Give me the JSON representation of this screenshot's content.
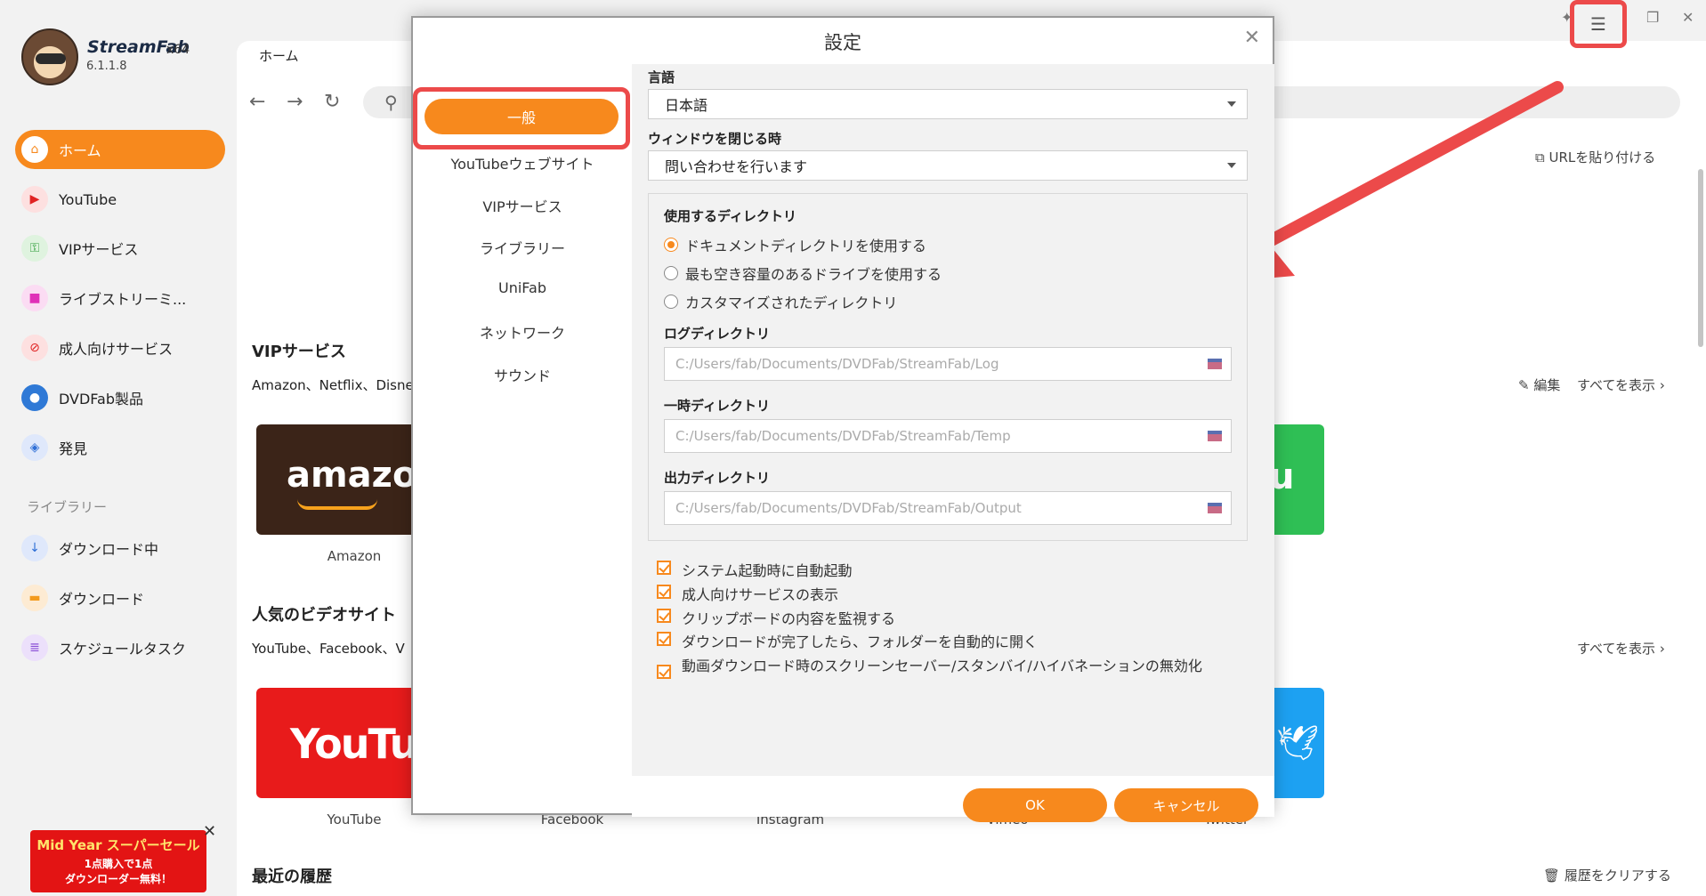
{
  "app": {
    "brand": "StreamFab",
    "arch": "x64",
    "version": "6.1.1.8"
  },
  "sidebar": {
    "items": [
      {
        "label": "ホーム",
        "icon": "home-icon"
      },
      {
        "label": "YouTube",
        "icon": "youtube-icon"
      },
      {
        "label": "VIPサービス",
        "icon": "key-icon"
      },
      {
        "label": "ライブストリーミ...",
        "icon": "live-camera-icon"
      },
      {
        "label": "成人向けサービス",
        "icon": "adult-block-icon"
      },
      {
        "label": "DVDFab製品",
        "icon": "dvdfab-icon"
      },
      {
        "label": "発見",
        "icon": "compass-icon"
      }
    ],
    "library_label": "ライブラリー",
    "library_items": [
      {
        "label": "ダウンロード中",
        "icon": "download-icon"
      },
      {
        "label": "ダウンロード",
        "icon": "folder-icon"
      },
      {
        "label": "スケジュールタスク",
        "icon": "schedule-icon"
      }
    ],
    "promo": {
      "line1": "Mid Year スーパーセール",
      "line2": "1点購入で1点",
      "line3": "ダウンローダー無料！"
    }
  },
  "main": {
    "tab": "ホーム",
    "paste_url": "URLを貼り付ける",
    "vip_title": "VIPサービス",
    "vip_sub": "Amazon、Netflix、Disne",
    "vip_edit": "編集",
    "vip_show_all": "すべてを表示",
    "vip_tile_label": "Amazon",
    "vip_tile_text": "amazon",
    "popular_title": "人気のビデオサイト",
    "popular_sub": "YouTube、Facebook、V",
    "popular_show_all": "すべてを表示",
    "popular_labels": [
      "YouTube",
      "Facebook",
      "Instagram",
      "Vimeo",
      "Twitter"
    ],
    "youtube_tile_text": "YouTube",
    "recent_title": "最近の履歴",
    "clear_history": "履歴をクリアする"
  },
  "dialog": {
    "title": "設定",
    "nav": [
      "一般",
      "YouTubeウェブサイト",
      "VIPサービス",
      "ライブラリー",
      "UniFab",
      "ネットワーク",
      "サウンド"
    ],
    "language_label": "言語",
    "language_value": "日本語",
    "close_label": "ウィンドウを閉じる時",
    "close_value": "問い合わせを行います",
    "dir_label": "使用するディレクトリ",
    "radios": [
      "ドキュメントディレクトリを使用する",
      "最も空き容量のあるドライブを使用する",
      "カスタマイズされたディレクトリ"
    ],
    "log_label": "ログディレクトリ",
    "log_path": "C:/Users/fab/Documents/DVDFab/StreamFab/Log",
    "temp_label": "一時ディレクトリ",
    "temp_path": "C:/Users/fab/Documents/DVDFab/StreamFab/Temp",
    "output_label": "出力ディレクトリ",
    "output_path": "C:/Users/fab/Documents/DVDFab/StreamFab/Output",
    "checks": [
      "システム起動時に自動起動",
      "成人向けサービスの表示",
      "クリップボードの内容を監視する",
      "ダウンロードが完了したら、フォルダーを自動的に開く",
      "動画ダウンロード時のスクリーンセーバー/スタンバイ/ハイバネーションの無効化"
    ],
    "ok": "OK",
    "cancel": "キャンセル"
  },
  "colors": {
    "accent": "#f7891d",
    "highlight": "#ec4a4a"
  }
}
